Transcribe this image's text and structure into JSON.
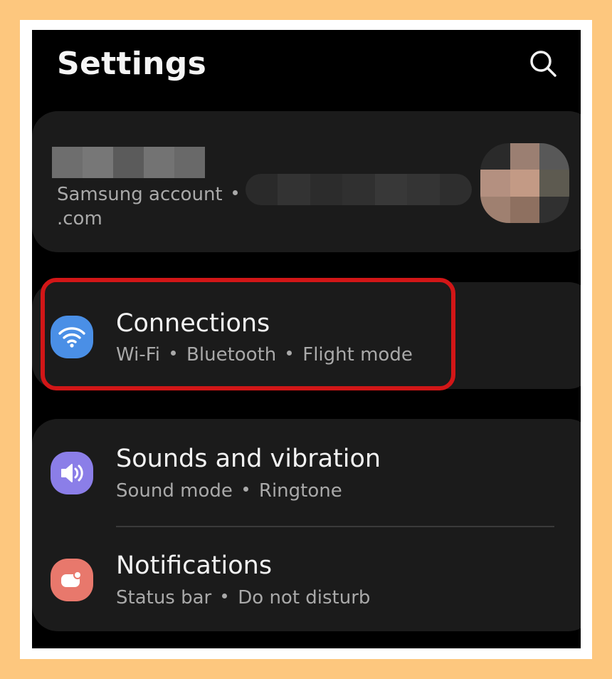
{
  "header": {
    "title": "Settings",
    "search_icon": "search-icon"
  },
  "account": {
    "label": "Samsung account",
    "email_suffix": ".com",
    "avatar_icon": "avatar"
  },
  "items": [
    {
      "id": "connections",
      "title": "Connections",
      "subtitle": [
        "Wi-Fi",
        "Bluetooth",
        "Flight mode"
      ],
      "icon": "wifi-icon",
      "icon_color": "#4a8fe6",
      "highlighted": true
    },
    {
      "id": "sounds",
      "title": "Sounds and vibration",
      "subtitle": [
        "Sound mode",
        "Ringtone"
      ],
      "icon": "speaker-icon",
      "icon_color": "#8b7ee8"
    },
    {
      "id": "notifications",
      "title": "Notifications",
      "subtitle": [
        "Status bar",
        "Do not disturb"
      ],
      "icon": "notification-badge-icon",
      "icon_color": "#e8786c"
    }
  ],
  "colors": {
    "background": "#000000",
    "card": "#1b1b1b",
    "highlight": "#d21617",
    "page_border": "#fdc77e"
  }
}
